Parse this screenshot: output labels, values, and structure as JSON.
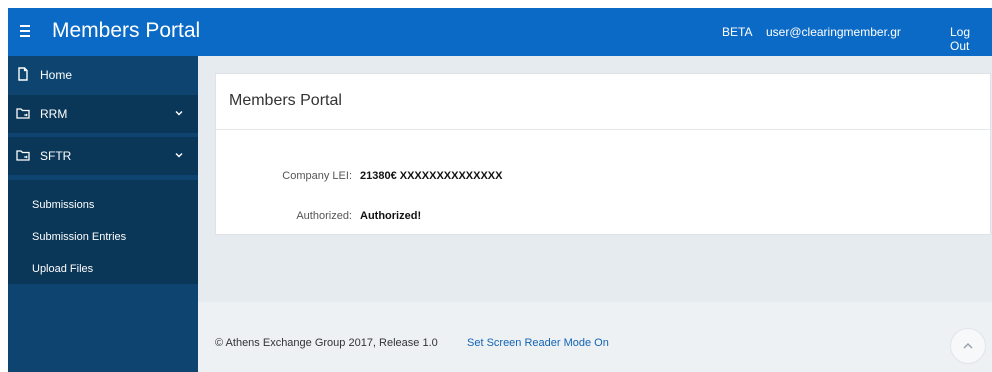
{
  "header": {
    "menu_icon": "hamburger-menu-icon",
    "title": "Members Portal",
    "badge": "BETA",
    "user": "user@clearingmember.gr",
    "logout": "Log Out",
    "color": "#0b6ac5"
  },
  "sidebar": {
    "color": "#0d4570",
    "items": [
      {
        "label": "Home",
        "icon": "page-icon"
      },
      {
        "label": "RRM",
        "icon": "folder-icon",
        "chevron": "chevron-down-icon"
      },
      {
        "label": "SFTR",
        "icon": "folder-icon",
        "chevron": "chevron-down-icon"
      }
    ],
    "submenu": [
      "Submissions",
      "Submission Entries",
      "Upload Files"
    ]
  },
  "card": {
    "title": "Members Portal",
    "lei_label": "Company LEI:",
    "lei_value": "21380€ XXXXXXXXXXXXXX",
    "auth_label": "Authorized:",
    "auth_value": "Authorized!"
  },
  "footer": {
    "copyright": "© Athens Exchange Group 2017, Release 1.0",
    "screen_reader": "Set Screen Reader Mode On",
    "to_top_icon": "chevron-up-icon"
  }
}
